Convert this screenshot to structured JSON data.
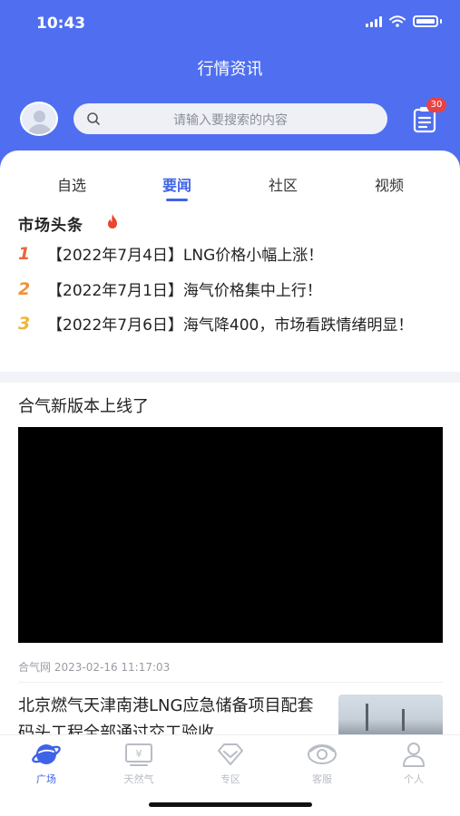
{
  "status_bar": {
    "time": "10:43"
  },
  "header": {
    "title": "行情资讯",
    "search_placeholder": "请输入要搜索的内容",
    "notice_badge": "30"
  },
  "tabs": [
    {
      "label": "自选",
      "active": false
    },
    {
      "label": "要闻",
      "active": true
    },
    {
      "label": "社区",
      "active": false
    },
    {
      "label": "视频",
      "active": false
    }
  ],
  "headlines": {
    "section_title": "市场头条",
    "items": [
      {
        "rank": "1",
        "rank_color": "#e8683a",
        "title": "【2022年7月4日】LNG价格小幅上涨！"
      },
      {
        "rank": "2",
        "rank_color": "#f0913a",
        "title": "【2022年7月1日】海气价格集中上行！"
      },
      {
        "rank": "3",
        "rank_color": "#f2b43a",
        "title": "【2022年7月6日】海气降400，市场看跌情绪明显！"
      }
    ]
  },
  "feed": [
    {
      "title": "合气新版本上线了",
      "source": "合气网",
      "datetime": "2023-02-16 11:17:03"
    },
    {
      "title": "北京燃气天津南港LNG应急储备项目配套码头工程全部通过交工验收"
    }
  ],
  "tabbar": [
    {
      "label": "广场",
      "icon": "planet-icon",
      "active": true
    },
    {
      "label": "天然气",
      "icon": "yen-icon",
      "active": false
    },
    {
      "label": "专区",
      "icon": "diamond-icon",
      "active": false
    },
    {
      "label": "客服",
      "icon": "headset-icon",
      "active": false
    },
    {
      "label": "个人",
      "icon": "person-icon",
      "active": false
    }
  ],
  "colors": {
    "brand": "#4f6ff0",
    "accent": "#3f63e8",
    "badge": "#e94242"
  }
}
